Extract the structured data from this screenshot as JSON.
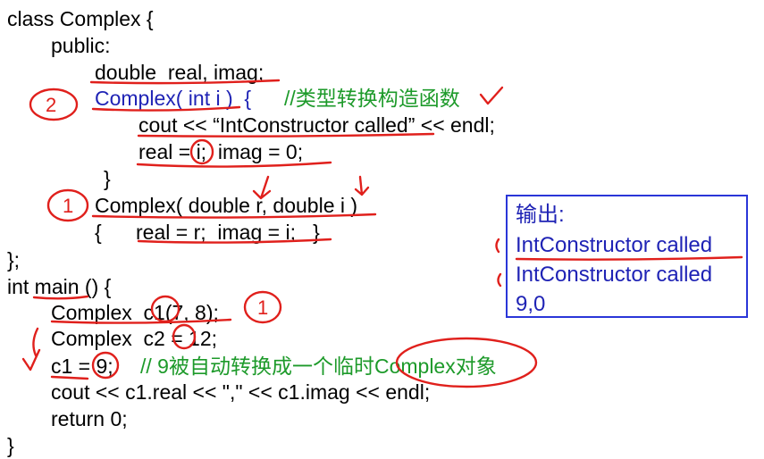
{
  "code": {
    "line1": "class Complex {",
    "line2": "public:",
    "line3": "double  real, imag;",
    "line4_sig": "Complex( int i )  {",
    "line4_comment": "//类型转换构造函数",
    "line5": "cout << “IntConstructor called” << endl;",
    "line6": "real = i;  imag = 0;",
    "line7": "}",
    "line8": "Complex( double r, double i )",
    "line9": "{      real = r;  imag = i;   }",
    "line10": "};",
    "line11": "int main () {",
    "line12": "Complex  c1(7, 8);",
    "line13": "Complex  c2 = 12;",
    "line14_code": "c1 = 9;",
    "line14_comment": "// 9被自动转换成一个临时Complex对象",
    "line15": "cout << c1.real << \",\" << c1.imag << endl;",
    "line16": "return 0;",
    "line17": "}"
  },
  "output": {
    "title": "输出:",
    "line1": "IntConstructor called",
    "line2": "IntConstructor called",
    "line3": "9,0"
  },
  "annotations": {
    "marker_a": "2",
    "marker_b": "1",
    "marker_c": "1"
  },
  "colors": {
    "code_text": "#000000",
    "blue_text": "#1f23b5",
    "comment_green": "#1d9a2a",
    "ink_red": "#e0201c",
    "box_border": "#2a36d8"
  }
}
